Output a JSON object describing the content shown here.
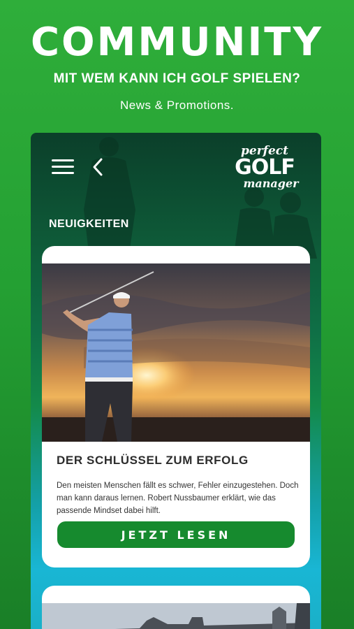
{
  "promo": {
    "title": "COMMUNITY",
    "subtitle": "MIT WEM KANN ICH GOLF SPIELEN?",
    "tagline": "News & Promotions."
  },
  "header": {
    "logo": {
      "line1": "perfect",
      "line2": "GOLF",
      "line3": "manager"
    },
    "menu_icon": "hamburger-menu-icon",
    "back_icon": "chevron-left-icon"
  },
  "section": {
    "label": "NEUIGKEITEN"
  },
  "articles": [
    {
      "title": "DER SCHLÜSSEL ZUM ERFOLG",
      "body": "Den meisten Menschen fällt es schwer, Fehler einzugestehen. Doch man kann daraus lernen. Robert Nussbaumer erklärt, wie das passende Mindset dabei hilft.",
      "button_label": "JETZT LESEN"
    }
  ],
  "colors": {
    "background": "#24a033",
    "button": "#168a2e",
    "card": "#ffffff"
  }
}
